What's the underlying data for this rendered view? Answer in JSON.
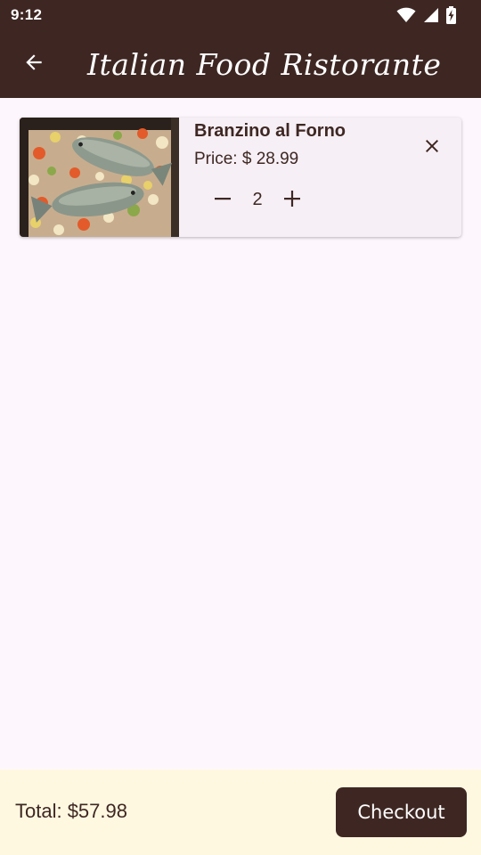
{
  "status_bar": {
    "time": "9:12",
    "icons": [
      "wifi-icon",
      "signal-icon",
      "battery-charging-icon"
    ]
  },
  "app_bar": {
    "back_icon": "arrow-back-icon",
    "title": "Italian Food Ristorante"
  },
  "cart": {
    "items": [
      {
        "name": "Branzino al Forno",
        "price_text": "Price: $ 28.99",
        "quantity": "2",
        "image": "baked-sea-bream-with-vegetables",
        "decrement_icon": "minus-icon",
        "increment_icon": "plus-icon",
        "remove_icon": "close-icon"
      }
    ]
  },
  "footer": {
    "total_text": "Total: $57.98",
    "checkout_label": "Checkout"
  },
  "colors": {
    "primary": "#3e2723",
    "background": "#fdf7fd",
    "card": "#f6eff5",
    "footer": "#fff8e1"
  }
}
